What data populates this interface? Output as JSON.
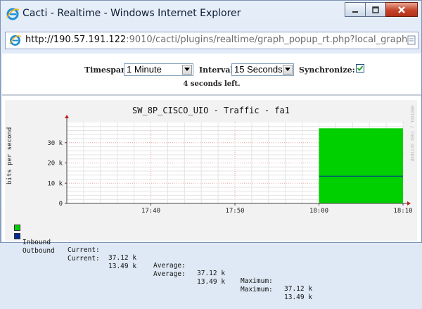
{
  "window": {
    "title": "Cacti - Realtime - Windows Internet Explorer",
    "url_host": "http://190.57.191.122",
    "url_path": ":9010/cacti/plugins/realtime/graph_popup_rt.php?local_graph_"
  },
  "controls": {
    "timespan_label": "Timespan:",
    "timespan_value": "1 Minute",
    "interval_label": "Interval:",
    "interval_value": "15 Seconds",
    "synchronize_label": "Synchronize:",
    "synchronize_checked": true,
    "countdown": "4 seconds left."
  },
  "graph": {
    "watermark": "RRDTOOL / TOBI OETIKER",
    "legend": [
      {
        "name": "Inbound",
        "color": "#00CF00",
        "current_label": "Current:",
        "current": "37.12 k",
        "average_label": "Average:",
        "average": "37.12 k",
        "maximum_label": "Maximum:",
        "maximum": "37.12 k"
      },
      {
        "name": "Outbound",
        "color": "#002A97",
        "current_label": "Current:",
        "current": "13.49 k",
        "average_label": "Average:",
        "average": "13.49 k",
        "maximum_label": "Maximum:",
        "maximum": "13.49 k"
      }
    ]
  },
  "chart_data": {
    "type": "area",
    "title": "SW_8P_CISCO_UIO - Traffic - fa1",
    "ylabel": "bits per second",
    "ylim": [
      0,
      40000
    ],
    "yticks": [
      0,
      10000,
      20000,
      30000
    ],
    "ytick_labels": [
      "0",
      "10 k",
      "20 k",
      "30 k"
    ],
    "xticks": [
      "17:40",
      "17:50",
      "18:00",
      "18:10"
    ],
    "x_range_minutes": [
      0,
      40
    ],
    "xtick_minutes": [
      10,
      20,
      30,
      40
    ],
    "series": [
      {
        "name": "Inbound",
        "kind": "area",
        "color": "#00CF00",
        "x_start_minutes": 30,
        "x_end_minutes": 40,
        "value": 37120
      },
      {
        "name": "Outbound",
        "kind": "line",
        "color": "#002A97",
        "x_start_minutes": 30,
        "x_end_minutes": 40,
        "value": 13490
      }
    ],
    "grid": true
  }
}
